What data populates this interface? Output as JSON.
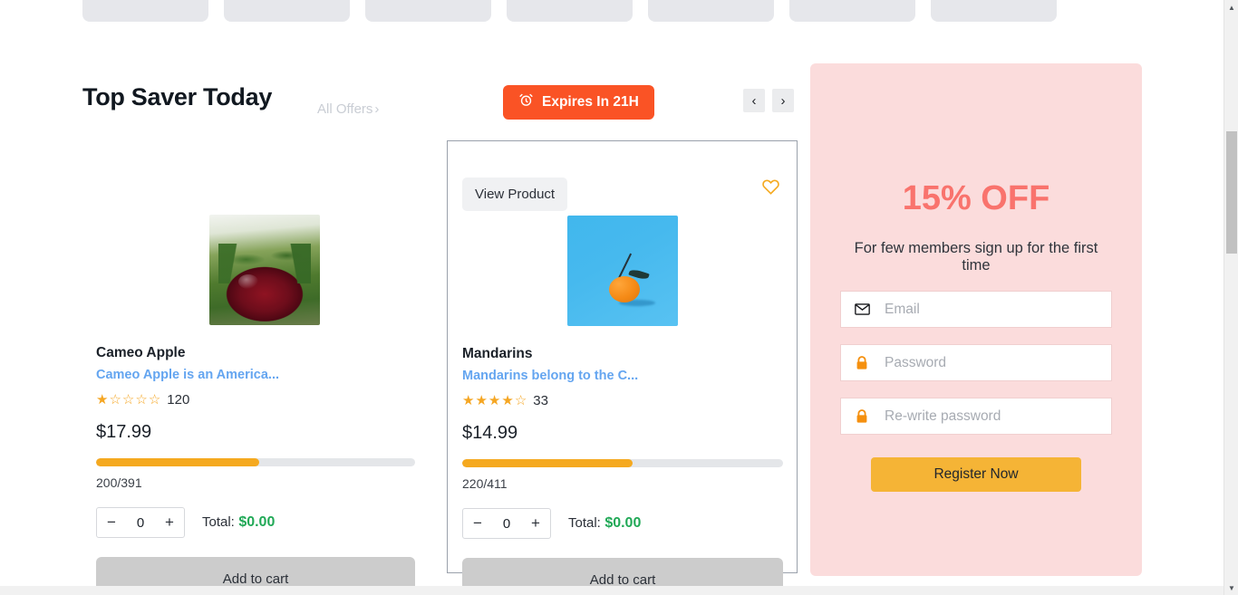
{
  "placeholders": {
    "count": 7
  },
  "section": {
    "title": "Top Saver Today",
    "all_offers": "All Offers",
    "all_offers_chevron": "›",
    "expires_label": "Expires In 21H",
    "alarm_icon": "alarm-clock-icon",
    "prev_label": "‹",
    "next_label": "›"
  },
  "products": [
    {
      "name": "Cameo Apple",
      "description": "Cameo Apple is an America...",
      "stars_filled": 1,
      "stars_total": 5,
      "rating_count": "120",
      "price": "$17.99",
      "progress_label": "200/391",
      "progress_percent": 51,
      "quantity": "0",
      "total_label": "Total:",
      "total_amount": "$0.00",
      "add_to_cart": "Add to cart",
      "image": "cameo-apple-photo"
    },
    {
      "name": "Mandarins",
      "description": "Mandarins belong to the C...",
      "stars_filled": 4,
      "stars_total": 5,
      "rating_count": "33",
      "price": "$14.99",
      "progress_label": "220/411",
      "progress_percent": 53,
      "quantity": "0",
      "total_label": "Total:",
      "total_amount": "$0.00",
      "add_to_cart": "Add to cart",
      "view_product": "View Product",
      "favorite_icon": "heart-outline-icon",
      "image": "mandarin-photo"
    }
  ],
  "promo": {
    "title": "15% OFF",
    "subtitle": "For few members sign up for the first time",
    "email_placeholder": "Email",
    "email_icon": "envelope-icon",
    "password_placeholder": "Password",
    "password_icon": "lock-icon",
    "confirm_placeholder": "Re-write password",
    "confirm_icon": "lock-icon",
    "email_value": "",
    "password_value": "",
    "confirm_value": "",
    "register_label": "Register Now"
  },
  "scrollbar": {
    "up_arrow": "▲",
    "down_arrow": "▼"
  },
  "colors": {
    "accent_orange": "#fa5325",
    "amber": "#f5a91f",
    "promo_bg": "#fbdcdc",
    "promo_title": "#f9736d",
    "link_blue": "#64a5f0",
    "total_green": "#21a957",
    "register_btn": "#f5b436"
  }
}
